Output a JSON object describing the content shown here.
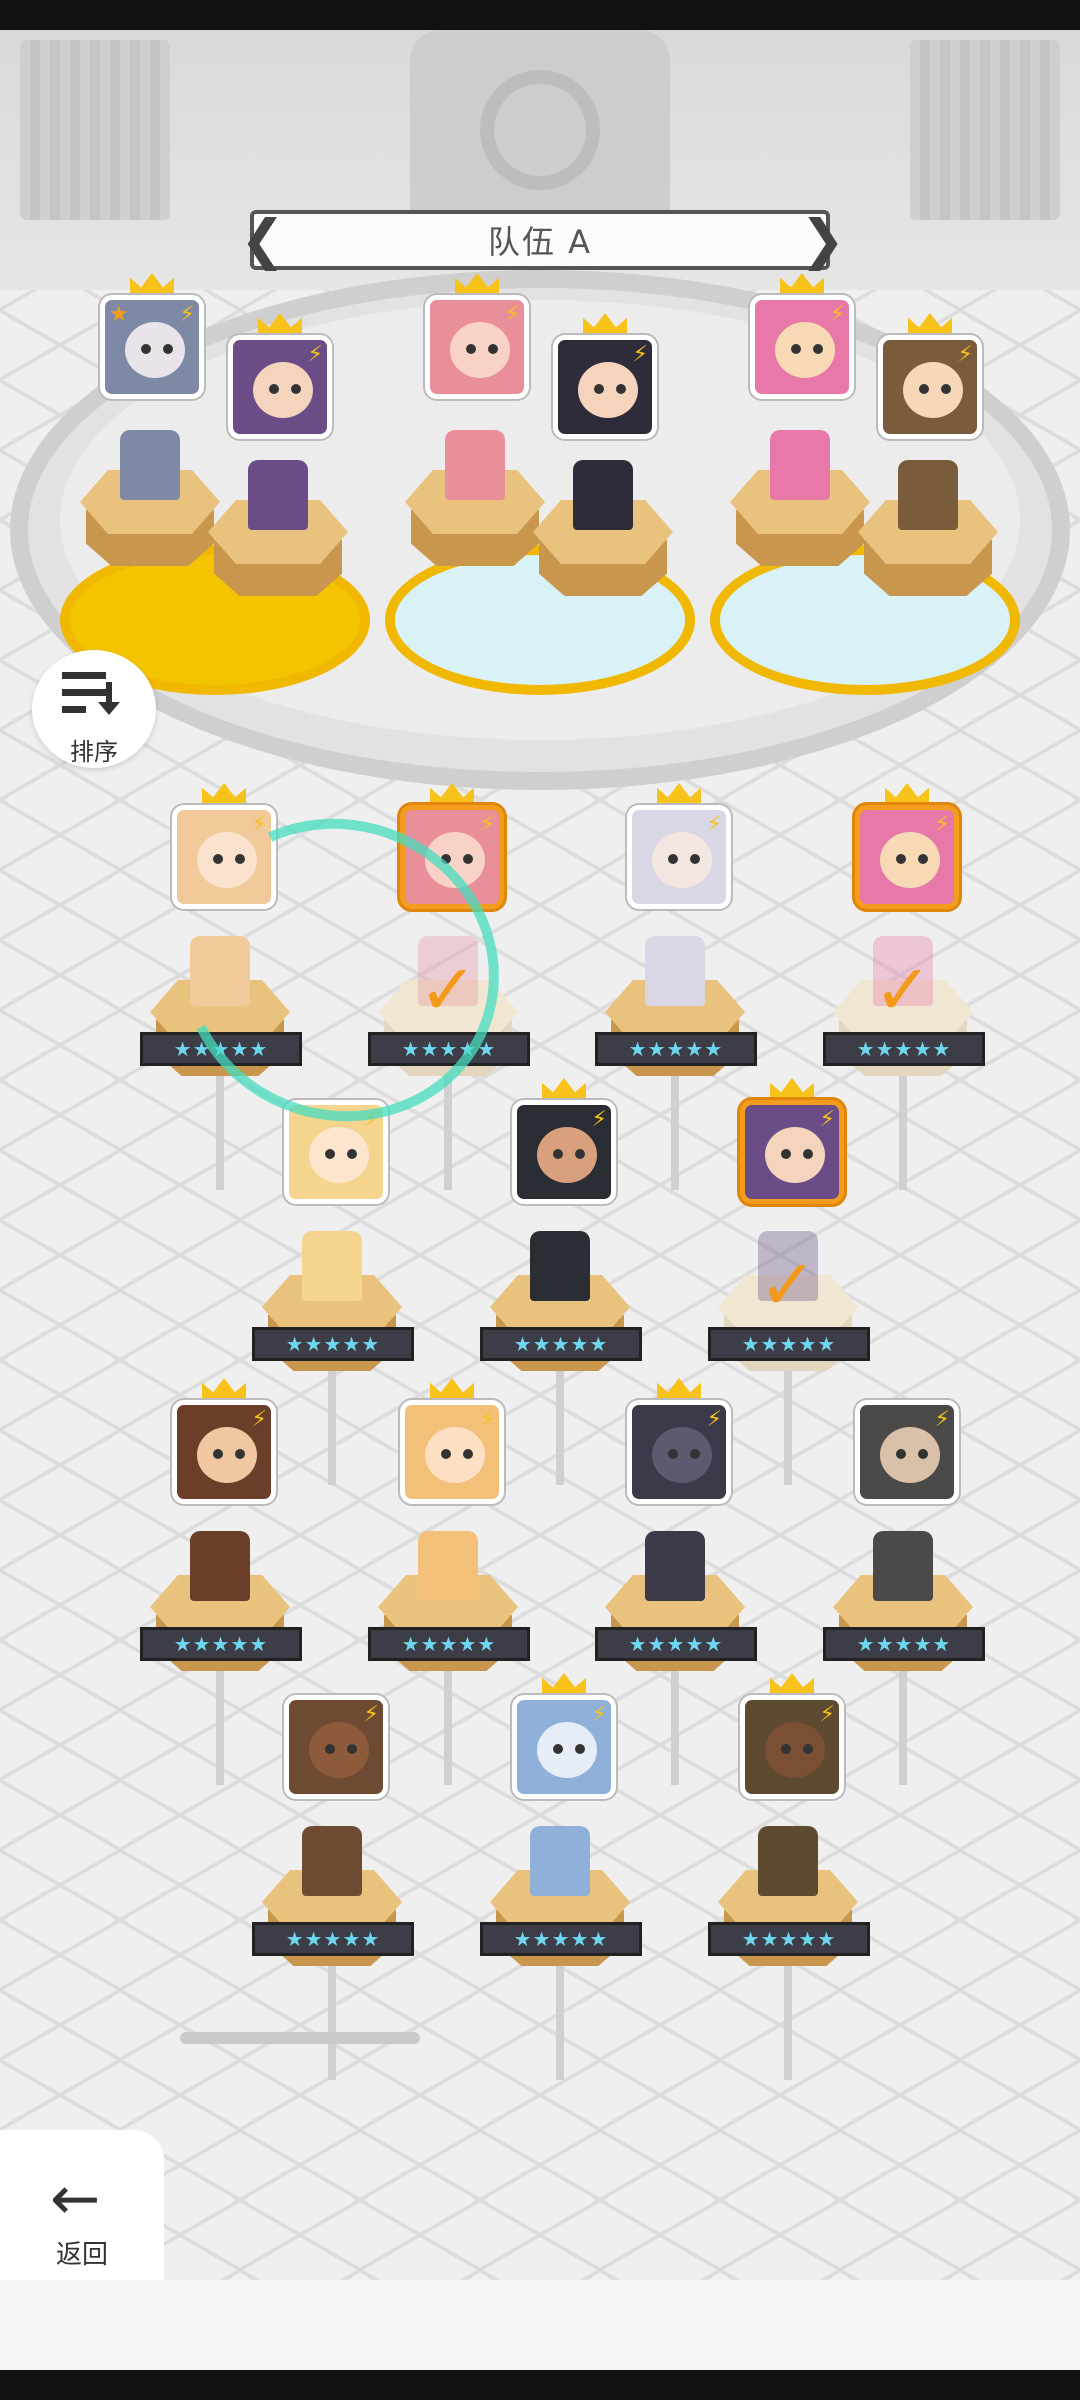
{
  "team_title": "队伍 A",
  "sort_label": "排序",
  "back_label": "返回",
  "arrows": {
    "left": "❮",
    "right": "❯"
  },
  "icons": {
    "sort": "sort-icon",
    "back": "back-arrow-icon",
    "bolt": "lightning-icon",
    "crown": "crown-icon",
    "check": "checkmark-icon"
  },
  "colors": {
    "selected_border": "#f39c1e",
    "crown": "#f7c21a",
    "stars": "#6fd6f0",
    "check": "#f39a1a",
    "ring_yellow": "#f5c400",
    "ring_blue": "#d8f2f8"
  },
  "team_slots": [
    {
      "ring": "yellow",
      "members": [
        {
          "portrait": "#7e8aa5",
          "face": "#e9e4ea",
          "stars": 5,
          "crowned": true,
          "star_badge": true
        },
        {
          "portrait": "#6a4d86",
          "face": "#f4d4bd",
          "stars": 5,
          "crowned": true
        }
      ]
    },
    {
      "ring": "blue",
      "members": [
        {
          "portrait": "#e98f9a",
          "face": "#f8d2c6",
          "stars": 5,
          "crowned": true
        },
        {
          "portrait": "#2e2b3a",
          "face": "#f5d3bd",
          "stars": 5,
          "crowned": true
        }
      ]
    },
    {
      "ring": "blue",
      "members": [
        {
          "portrait": "#e878a8",
          "face": "#f7d9b6",
          "stars": 5,
          "crowned": true
        },
        {
          "portrait": "#7a5b3c",
          "face": "#f6d7b8",
          "stars": 5,
          "crowned": true
        }
      ]
    }
  ],
  "roster": [
    {
      "portrait": "#f2c99a",
      "face": "#fbe2cc",
      "crowned": true,
      "selected": false,
      "in_team": false
    },
    {
      "portrait": "#e98f9a",
      "face": "#f8d2c6",
      "crowned": true,
      "selected": true,
      "in_team": true
    },
    {
      "portrait": "#d9d6e6",
      "face": "#f3e6e0",
      "crowned": true,
      "selected": false,
      "in_team": false
    },
    {
      "portrait": "#e878a8",
      "face": "#f7d9b6",
      "crowned": true,
      "selected": true,
      "in_team": true
    },
    {
      "portrait": "#f5d48e",
      "face": "#fde5cd",
      "crowned": false,
      "selected": false,
      "in_team": false
    },
    {
      "portrait": "#2a2d33",
      "face": "#d9a07e",
      "crowned": true,
      "selected": false,
      "in_team": false
    },
    {
      "portrait": "#6a4d86",
      "face": "#f4d4bd",
      "crowned": true,
      "selected": true,
      "in_team": true
    },
    {
      "portrait": "#e6e6e6",
      "face": "#f2f2f2",
      "crowned": false,
      "selected": false,
      "in_team": false
    },
    {
      "portrait": "#6b3e2a",
      "face": "#f0c7a1",
      "crowned": true,
      "selected": false,
      "in_team": false
    },
    {
      "portrait": "#f3c07a",
      "face": "#fde0c4",
      "crowned": true,
      "selected": false,
      "in_team": false
    },
    {
      "portrait": "#3b3a4a",
      "face": "#5b5a6e",
      "crowned": true,
      "selected": false,
      "in_team": false
    },
    {
      "portrait": "#4b4a49",
      "face": "#d8c1a8",
      "crowned": false,
      "selected": false,
      "in_team": false
    },
    {
      "portrait": "#6e4a33",
      "face": "#8e5a3c",
      "crowned": false,
      "selected": false,
      "in_team": false
    },
    {
      "portrait": "#8fb0d9",
      "face": "#e7edf6",
      "crowned": true,
      "selected": false,
      "in_team": false
    },
    {
      "portrait": "#5d4a2f",
      "face": "#7a4f33",
      "crowned": true,
      "selected": false,
      "in_team": false
    },
    {
      "portrait": "#7e8aa5",
      "face": "#e9e4ea",
      "crowned": true,
      "selected": true,
      "in_team": true
    }
  ],
  "star_text": "★★★★★"
}
